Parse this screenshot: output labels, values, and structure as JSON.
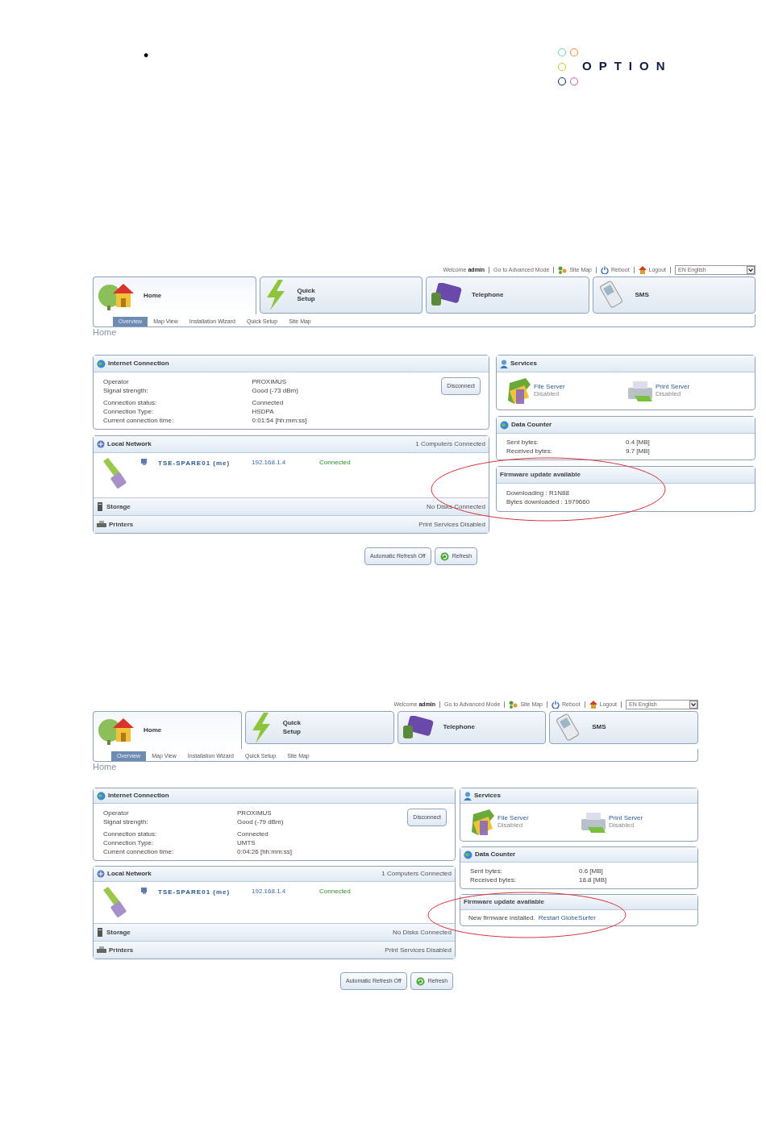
{
  "header": {
    "bullet": "•",
    "logo": "OPTION"
  },
  "screenshots": [
    {
      "top_bar": {
        "welcome": "Welcome",
        "user": "admin",
        "links": [
          {
            "kind": "text",
            "label": "Go to Advanced Mode"
          },
          {
            "kind": "sitemap",
            "label": "Site Map"
          },
          {
            "kind": "power",
            "label": "Reboot"
          },
          {
            "kind": "logout",
            "label": "Logout"
          }
        ],
        "language": "EN English"
      },
      "main_tabs": [
        {
          "kind": "home",
          "label": "Home",
          "selected": true
        },
        {
          "kind": "bolt",
          "label": "Quick Setup",
          "selected": false
        },
        {
          "kind": "phone",
          "label": "Telephone",
          "selected": false
        },
        {
          "kind": "mobile",
          "label": "SMS",
          "selected": false
        }
      ],
      "sub_tabs": [
        {
          "label": "Overview",
          "selected": true
        },
        {
          "label": "Map View",
          "selected": false
        },
        {
          "label": "Installation Wizard",
          "selected": false
        },
        {
          "label": "Quick Setup",
          "selected": false
        },
        {
          "label": "Site Map",
          "selected": false
        }
      ],
      "breadcrumb": "Home",
      "internet_connection": {
        "title": "Internet Connection",
        "groups": [
          [
            {
              "label": "Operator",
              "value": "PROXIMUS"
            },
            {
              "label": "Signal strength:",
              "value": "Good (-73 dBm)"
            }
          ],
          [
            {
              "label": "Connection status:",
              "value": "Connected"
            },
            {
              "label": "Connection Type:",
              "value": "HSDPA"
            },
            {
              "label": "Current connection time:",
              "value": "0:01:54 [hh:mm:ss]"
            }
          ]
        ],
        "button": "Disconnect"
      },
      "local_network": {
        "title": "Local Network",
        "summary": "1 Computers Connected",
        "devices": [
          {
            "name": "TSE-SPARE01 (me)",
            "ip": "192.168.1.4",
            "status": "Connected"
          }
        ]
      },
      "sections": [
        {
          "kind": "storage",
          "title": "Storage",
          "summary": "No Disks Connected"
        },
        {
          "kind": "printer",
          "title": "Printers",
          "summary": "Print Services Disabled"
        }
      ],
      "services": {
        "title": "Services",
        "items": [
          {
            "kind": "folder",
            "name": "File Server",
            "status": "Disabled"
          },
          {
            "kind": "printer",
            "name": "Print Server",
            "status": "Disabled"
          }
        ]
      },
      "data_counter": {
        "title": "Data Counter",
        "rows": [
          {
            "label": "Sent bytes:",
            "value": "0.4 [MB]"
          },
          {
            "label": "Received bytes:",
            "value": "9.7 [MB]"
          }
        ]
      },
      "firmware": {
        "title": "Firmware update available",
        "highlighted": true,
        "lines": [
          {
            "text": "Downloading : R1N88"
          },
          {
            "text": "Bytes downloaded : 1979660"
          }
        ]
      },
      "buttons": [
        {
          "kind": "text",
          "label": "Automatic Refresh Off"
        },
        {
          "kind": "refresh",
          "label": "Refresh"
        }
      ]
    },
    {
      "top_bar": {
        "welcome": "Welcome",
        "user": "admin",
        "links": [
          {
            "kind": "text",
            "label": "Go to Advanced Mode"
          },
          {
            "kind": "sitemap",
            "label": "Site Map"
          },
          {
            "kind": "power",
            "label": "Reboot"
          },
          {
            "kind": "logout",
            "label": "Logout"
          }
        ],
        "language": "EN English"
      },
      "main_tabs": [
        {
          "kind": "home",
          "label": "Home",
          "selected": true
        },
        {
          "kind": "bolt",
          "label": "Quick Setup",
          "selected": false
        },
        {
          "kind": "phone",
          "label": "Telephone",
          "selected": false
        },
        {
          "kind": "mobile",
          "label": "SMS",
          "selected": false
        }
      ],
      "sub_tabs": [
        {
          "label": "Overview",
          "selected": true
        },
        {
          "label": "Map View",
          "selected": false
        },
        {
          "label": "Installation Wizard",
          "selected": false
        },
        {
          "label": "Quick Setup",
          "selected": false
        },
        {
          "label": "Site Map",
          "selected": false
        }
      ],
      "breadcrumb": "Home",
      "internet_connection": {
        "title": "Internet Connection",
        "groups": [
          [
            {
              "label": "Operator",
              "value": "PROXIMUS"
            },
            {
              "label": "Signal strength:",
              "value": "Good (-79 dBm)"
            }
          ],
          [
            {
              "label": "Connection status:",
              "value": "Connected"
            },
            {
              "label": "Connection Type:",
              "value": "UMTS"
            },
            {
              "label": "Current connection time:",
              "value": "0:04:26 [hh:mm:ss]"
            }
          ]
        ],
        "button": "Disconnect"
      },
      "local_network": {
        "title": "Local Network",
        "summary": "1 Computers Connected",
        "devices": [
          {
            "name": "TSE-SPARE01 (me)",
            "ip": "192.168.1.4",
            "status": "Connected"
          }
        ]
      },
      "sections": [
        {
          "kind": "storage",
          "title": "Storage",
          "summary": "No Disks Connected"
        },
        {
          "kind": "printer",
          "title": "Printers",
          "summary": "Print Services Disabled"
        }
      ],
      "services": {
        "title": "Services",
        "items": [
          {
            "kind": "folder",
            "name": "File Server",
            "status": "Disabled"
          },
          {
            "kind": "printer",
            "name": "Print Server",
            "status": "Disabled"
          }
        ]
      },
      "data_counter": {
        "title": "Data Counter",
        "rows": [
          {
            "label": "Sent bytes:",
            "value": "0.6 [MB]"
          },
          {
            "label": "Received bytes:",
            "value": "18.8 [MB]"
          }
        ]
      },
      "firmware": {
        "title": "Firmware update available",
        "highlighted": true,
        "lines": [
          {
            "text": "New firmware installed.",
            "link": "Restart GlobeSurfer"
          }
        ]
      },
      "buttons": [
        {
          "kind": "text",
          "label": "Automatic Refresh Off"
        },
        {
          "kind": "refresh",
          "label": "Refresh"
        }
      ]
    }
  ]
}
